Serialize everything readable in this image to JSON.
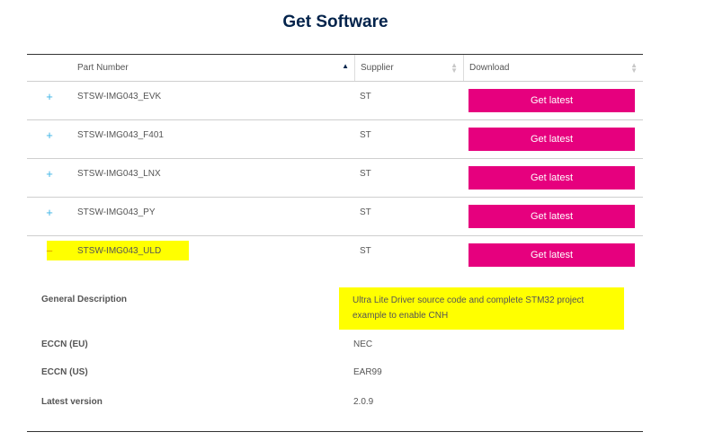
{
  "page": {
    "title": "Get Software"
  },
  "table": {
    "headers": {
      "part_number": "Part Number",
      "supplier": "Supplier",
      "download": "Download"
    },
    "rows": [
      {
        "expand": "+",
        "part_number": "STSW-IMG043_EVK",
        "supplier": "ST",
        "download": "Get latest"
      },
      {
        "expand": "+",
        "part_number": "STSW-IMG043_F401",
        "supplier": "ST",
        "download": "Get latest"
      },
      {
        "expand": "+",
        "part_number": "STSW-IMG043_LNX",
        "supplier": "ST",
        "download": "Get latest"
      },
      {
        "expand": "+",
        "part_number": "STSW-IMG043_PY",
        "supplier": "ST",
        "download": "Get latest"
      },
      {
        "expand": "−",
        "part_number": "STSW-IMG043_ULD",
        "supplier": "ST",
        "download": "Get latest"
      }
    ]
  },
  "details": {
    "general_description_label": "General Description",
    "general_description_value": "Ultra Lite Driver source code and complete STM32 project example to enable CNH",
    "eccn_eu_label": "ECCN (EU)",
    "eccn_eu_value": "NEC",
    "eccn_us_label": "ECCN (US)",
    "eccn_us_value": "EAR99",
    "latest_version_label": "Latest version",
    "latest_version_value": "2.0.9"
  },
  "colors": {
    "accent": "#e6007e",
    "title": "#03234b",
    "expand": "#3cb4e6",
    "highlight": "#ffff00"
  },
  "icons": {
    "sort_active": "sort-ascending-icon",
    "sort_inactive": "sort-icon",
    "expand": "plus-icon",
    "collapse": "minus-icon"
  }
}
